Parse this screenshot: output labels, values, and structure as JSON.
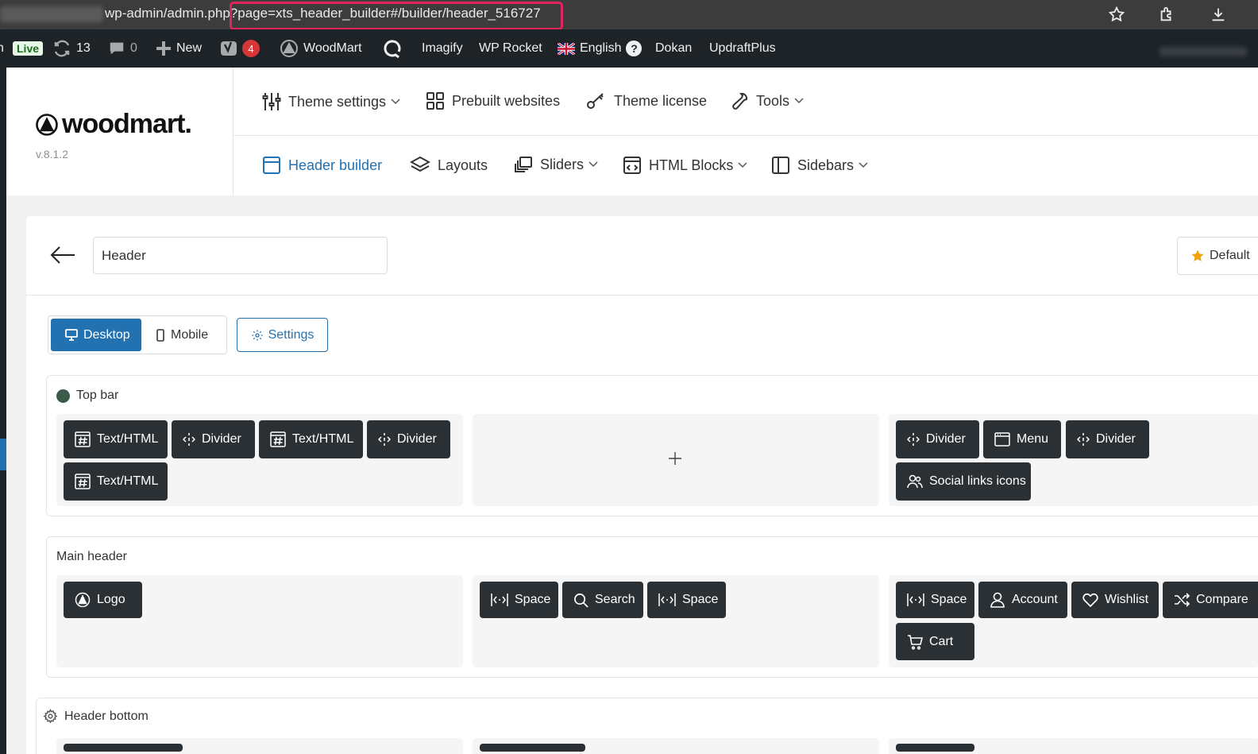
{
  "browser": {
    "url_text": "wp-admin/admin.php?page=xts_header_builder#/builder/header_516727"
  },
  "admin_bar": {
    "live": "Live",
    "updates_count": "13",
    "comments_count": "0",
    "new_label": "New",
    "yoast_count": "4",
    "woodmart": "WoodMart",
    "imagify": "Imagify",
    "wp_rocket": "WP Rocket",
    "language": "English",
    "help": "?",
    "dokan": "Dokan",
    "updraft": "UpdraftPlus"
  },
  "brand": {
    "logo_text": "woodmart.",
    "version": "v.8.1.2"
  },
  "nav_top": [
    {
      "label": "Theme settings"
    },
    {
      "label": "Prebuilt websites"
    },
    {
      "label": "Theme license"
    },
    {
      "label": "Tools"
    }
  ],
  "nav_bottom": [
    {
      "label": "Header builder"
    },
    {
      "label": "Layouts"
    },
    {
      "label": "Sliders"
    },
    {
      "label": "HTML Blocks"
    },
    {
      "label": "Sidebars"
    }
  ],
  "builder": {
    "header_name": "Header",
    "default_label": "Default",
    "device_desktop": "Desktop",
    "device_mobile": "Mobile",
    "settings": "Settings"
  },
  "rows": {
    "top_bar": {
      "title": "Top bar",
      "left": [
        "Text/HTML",
        "Divider",
        "Text/HTML",
        "Divider",
        "Text/HTML"
      ],
      "center_add": "+",
      "right": [
        "Divider",
        "Menu",
        "Divider",
        "Social links icons"
      ]
    },
    "main_header": {
      "title": "Main header",
      "left": [
        "Logo"
      ],
      "center": [
        "Space",
        "Search",
        "Space"
      ],
      "right": [
        "Space",
        "Account",
        "Wishlist",
        "Compare",
        "Cart"
      ]
    },
    "header_bottom": {
      "title": "Header bottom"
    }
  },
  "colors": {
    "accent": "#2271b1",
    "element_bg": "#2b3035",
    "admin_bar": "#1d2327",
    "highlight": "#e0245e"
  }
}
